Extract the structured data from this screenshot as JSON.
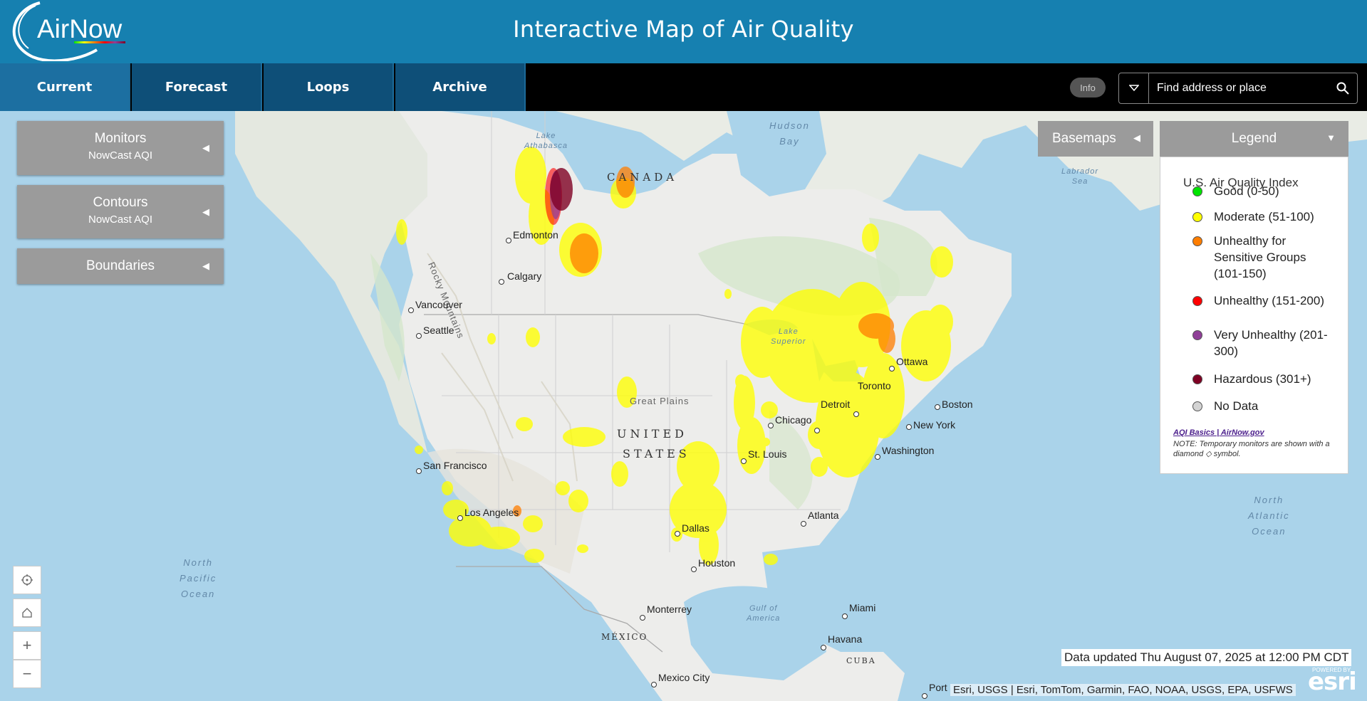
{
  "header": {
    "logo_text": "AirNow",
    "title": "Interactive Map of Air Quality"
  },
  "nav": {
    "tabs": [
      "Current",
      "Forecast",
      "Loops",
      "Archive"
    ],
    "active_tab": "Current",
    "info_label": "Info",
    "search_placeholder": "Find address or place"
  },
  "panels": {
    "monitors": {
      "title": "Monitors",
      "subtitle": "NowCast AQI"
    },
    "contours": {
      "title": "Contours",
      "subtitle": "NowCast AQI"
    },
    "boundaries": {
      "title": "Boundaries"
    },
    "basemaps": {
      "title": "Basemaps"
    }
  },
  "legend": {
    "header": "Legend",
    "title": "U.S. Air Quality Index",
    "items": [
      {
        "label": "Good (0-50)",
        "color": "#00e400"
      },
      {
        "label": "Moderate (51-100)",
        "color": "#ffff00"
      },
      {
        "label": "Unhealthy for Sensitive Groups (101-150)",
        "color": "#ff7e00"
      },
      {
        "label": "Unhealthy (151-200)",
        "color": "#ff0000"
      },
      {
        "label": "Very Unhealthy (201-300)",
        "color": "#8f3f97"
      },
      {
        "label": "Hazardous (301+)",
        "color": "#7e0023"
      },
      {
        "label": "No Data",
        "color": "#d3d3d3"
      }
    ],
    "link": "AQI Basics | AirNow.gov",
    "note": "NOTE: Temporary monitors are shown with a diamond ◇ symbol."
  },
  "map": {
    "cities": {
      "edmonton": "Edmonton",
      "calgary": "Calgary",
      "vancouver": "Vancouver",
      "seattle": "Seattle",
      "san_francisco": "San Francisco",
      "los_angeles": "Los Angeles",
      "dallas": "Dallas",
      "houston": "Houston",
      "monterrey": "Monterrey",
      "mexico_city": "Mexico City",
      "chicago": "Chicago",
      "detroit": "Detroit",
      "toronto": "Toronto",
      "ottawa": "Ottawa",
      "boston": "Boston",
      "new_york": "New York",
      "washington": "Washington",
      "st_louis": "St. Louis",
      "atlanta": "Atlanta",
      "miami": "Miami",
      "havana": "Havana",
      "port": "Port"
    },
    "regions": {
      "canada": "CANADA",
      "united": "UNITED",
      "states": "STATES",
      "mexico": "MÉXICO",
      "cuba": "CUBA",
      "great_plains": "Great Plains",
      "rocky_mountains": "Rocky Mountains"
    },
    "waters": {
      "hudson_bay_1": "Hudson",
      "hudson_bay_2": "Bay",
      "lake_athabasca_1": "Lake",
      "lake_athabasca_2": "Athabasca",
      "labrador_1": "Labrador",
      "labrador_2": "Sea",
      "lake_superior_1": "Lake",
      "lake_superior_2": "Superior",
      "gulf_1": "Gulf of",
      "gulf_2": "America",
      "n_pacific_1": "North",
      "n_pacific_2": "Pacific",
      "n_pacific_3": "Ocean",
      "n_atlantic_1": "North",
      "n_atlantic_2": "Atlantic",
      "n_atlantic_3": "Ocean"
    },
    "data_updated": "Data updated Thu August 07, 2025 at 12:00 PM CDT",
    "attribution": "Esri, USGS | Esri, TomTom, Garmin, FAO, NOAA, USGS, EPA, USFWS",
    "esri_powered": "POWERED BY",
    "esri_logo": "esri"
  }
}
